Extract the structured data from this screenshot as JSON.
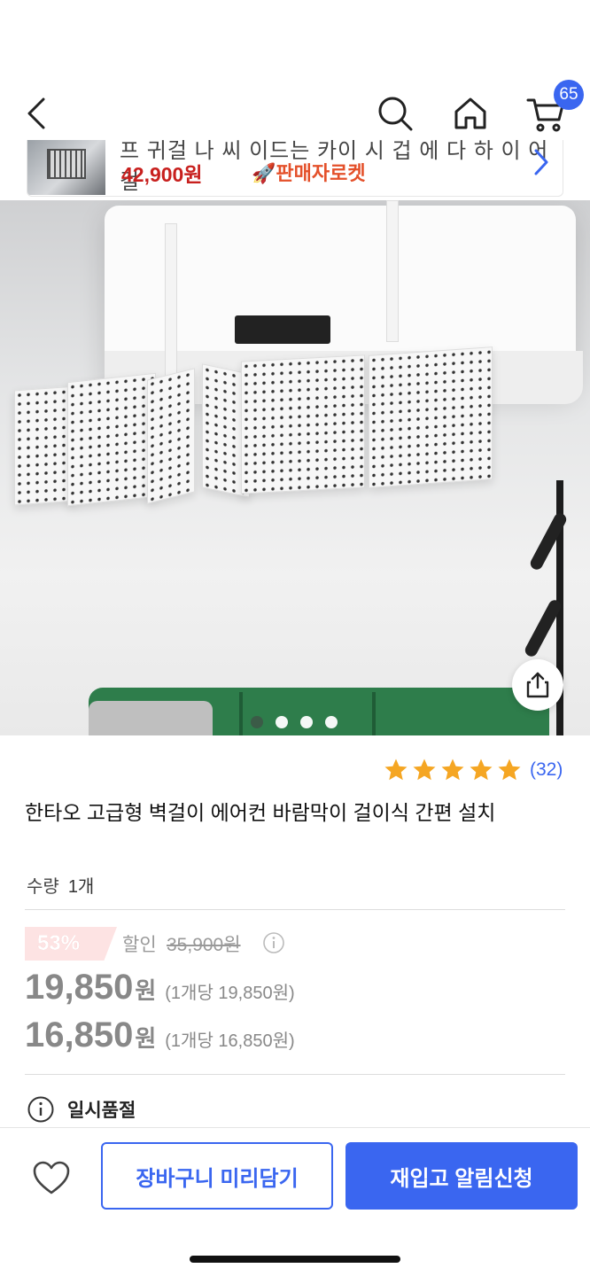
{
  "nav": {
    "cart_count": "65",
    "icons": [
      "back-icon",
      "search-icon",
      "home-icon",
      "cart-icon"
    ]
  },
  "banner": {
    "cut_text": "프 귀걸 나 씨 이드는 카이 시 겁 에 다 하 이 어 걸",
    "price": "42,900원",
    "rocket_label": "판매자로켓"
  },
  "carousel": {
    "dot_count": 4,
    "active_index": 0
  },
  "product": {
    "rating_stars": 5,
    "rating_count": "(32)",
    "title": "한타오 고급형 벽걸이 에어컨 바람막이 걸이식 간편 설치",
    "qty_label": "수량",
    "qty_value": "1개",
    "discount_percent": "53%",
    "discount_label": "할인",
    "original_price": "35,900원",
    "price1": "19,850",
    "price1_won": "원",
    "price1_unit": "(1개당 19,850원)",
    "price2": "16,850",
    "price2_won": "원",
    "price2_unit": "(1개당 16,850원)",
    "soldout_label": "일시품절"
  },
  "bottom": {
    "cart_button": "장바구니 미리담기",
    "notify_button": "재입고 알림신청"
  },
  "colors": {
    "accent": "#3a66f0",
    "star": "#f5a623",
    "discount": "#e86a6a",
    "banner_price": "#c8201e"
  }
}
